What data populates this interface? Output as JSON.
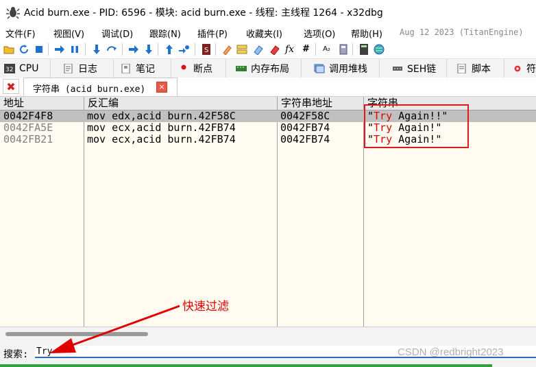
{
  "window": {
    "title": "Acid burn.exe - PID: 6596 - 模块: acid burn.exe - 线程: 主线程 1264 - x32dbg"
  },
  "menu": {
    "items": [
      "文件(F)",
      "视图(V)",
      "调试(D)",
      "跟踪(N)",
      "插件(P)",
      "收藏夹(I)",
      "选项(O)",
      "帮助(H)"
    ],
    "right_text": "Aug 12 2023 (TitanEngine)"
  },
  "toolbar": {
    "icons": [
      "open-icon",
      "restart-icon",
      "stop-icon",
      "run-icon",
      "pause-icon",
      "step-into-icon",
      "step-over-icon",
      "trace-into-icon",
      "trace-over-icon",
      "execute-till-return-icon",
      "run-to-user-code-icon",
      "scylla-icon",
      "patch-icon",
      "comment-icon",
      "label-icon",
      "bookmark-icon",
      "function-icon",
      "hash-icon",
      "font-icon",
      "calculator-icon",
      "globe-icon"
    ],
    "fx_label": "fx",
    "hash_label": "#",
    "font_label": "A₂"
  },
  "view_tabs": [
    {
      "label": "CPU",
      "icon": "cpu-icon"
    },
    {
      "label": "日志",
      "icon": "log-icon"
    },
    {
      "label": "笔记",
      "icon": "notes-icon"
    },
    {
      "label": "断点",
      "icon": "breakpoint-icon"
    },
    {
      "label": "内存布局",
      "icon": "memory-map-icon"
    },
    {
      "label": "调用堆栈",
      "icon": "call-stack-icon"
    },
    {
      "label": "SEH链",
      "icon": "seh-icon"
    },
    {
      "label": "脚本",
      "icon": "script-icon"
    },
    {
      "label": "符",
      "icon": "symbols-icon"
    }
  ],
  "sub_tabs": {
    "close_glyph": "✖",
    "tab_label": "字符串 (acid burn.exe)",
    "tab_close_glyph": "×"
  },
  "table": {
    "columns": [
      "地址",
      "反汇编",
      "字符串地址",
      "字符串"
    ],
    "rows": [
      {
        "address": "0042F4F8",
        "disasm": "mov edx,acid burn.42F58C",
        "str_addr": "0042F58C",
        "str_open": "\"",
        "str_match": "Try",
        "str_rest": " Again!!\"",
        "selected": true
      },
      {
        "address": "0042FA5E",
        "disasm": "mov ecx,acid burn.42FB74",
        "str_addr": "0042FB74",
        "str_open": "\"",
        "str_match": "Try",
        "str_rest": " Again!\"",
        "selected": false
      },
      {
        "address": "0042FB21",
        "disasm": "mov ecx,acid burn.42FB74",
        "str_addr": "0042FB74",
        "str_open": "\"",
        "str_match": "Try",
        "str_rest": " Again!\"",
        "selected": false
      }
    ]
  },
  "search": {
    "label": "搜索:",
    "value": "Try"
  },
  "annotation": {
    "text": "快速过滤",
    "color": "#e00000"
  },
  "watermark": "CSDN @redbright2023",
  "colors": {
    "highlight": "#e00000",
    "selected_row": "#c0c0c0",
    "grid_bg": "#fffbf0",
    "progress": "#2fa040"
  }
}
